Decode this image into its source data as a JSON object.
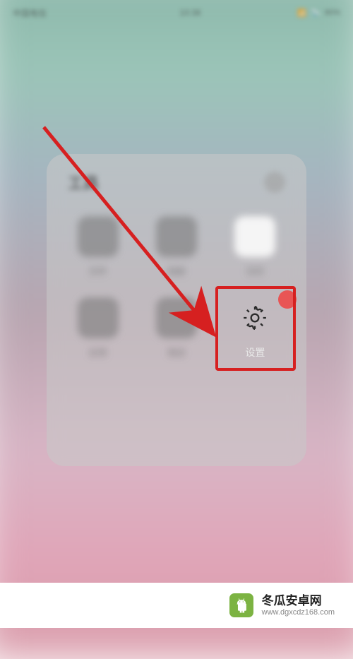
{
  "status": {
    "carrier": "中国电信",
    "time": "10:38",
    "battery": "80%"
  },
  "folder": {
    "title": "工具"
  },
  "apps": [
    {
      "label": "文件",
      "highlighted": false
    },
    {
      "label": "相册",
      "highlighted": false
    },
    {
      "label": "日历",
      "highlighted": false
    },
    {
      "label": "应用",
      "highlighted": false
    },
    {
      "label": "商店",
      "highlighted": false
    },
    {
      "label": "设置",
      "highlighted": true
    }
  ],
  "watermark": {
    "brand": "冬瓜安卓网",
    "url": "www.dgxcdz168.com"
  },
  "colors": {
    "highlight": "#d62020",
    "badge": "#e85555",
    "logo": "#7cb342"
  }
}
